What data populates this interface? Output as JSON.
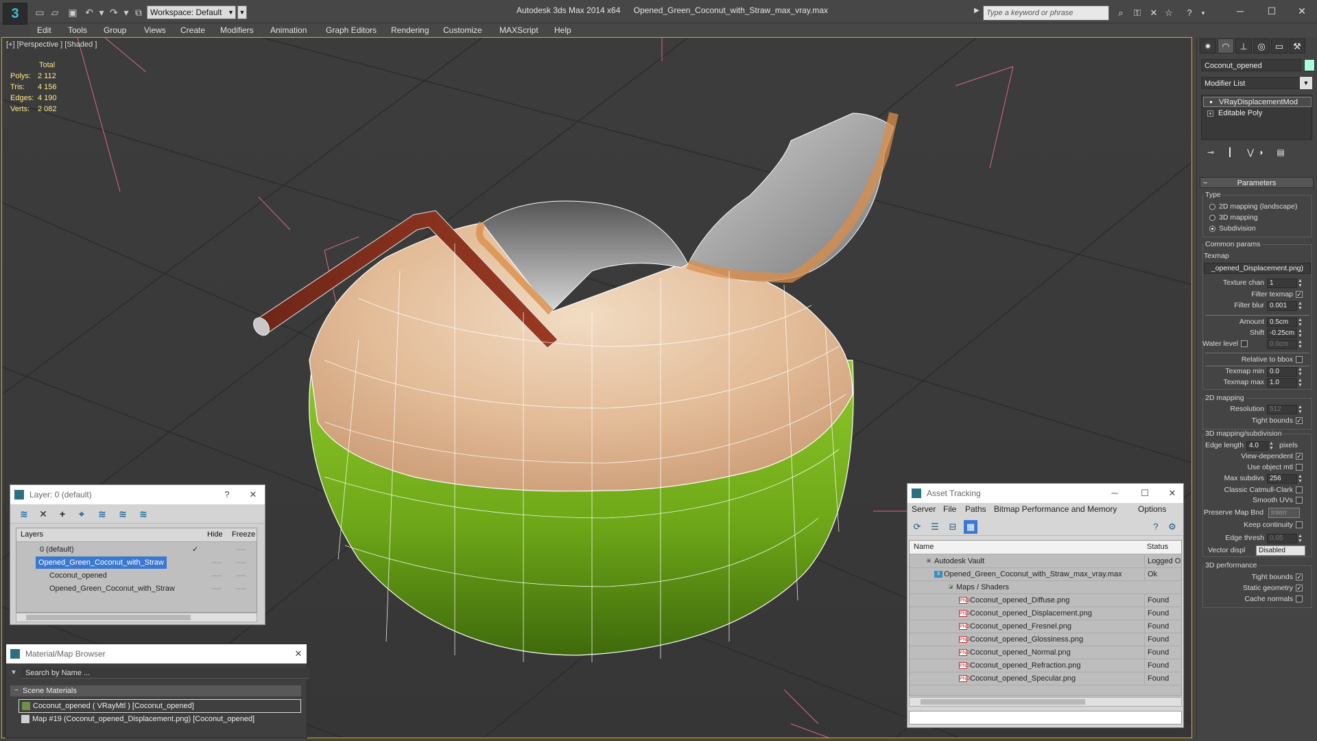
{
  "titlebar": {
    "workspace": "Workspace: Default",
    "app_name": "Autodesk 3ds Max  2014 x64",
    "file_name": "Opened_Green_Coconut_with_Straw_max_vray.max",
    "search_placeholder": "Type a keyword or phrase"
  },
  "menu": [
    "Edit",
    "Tools",
    "Group",
    "Views",
    "Create",
    "Modifiers",
    "Animation",
    "Graph Editors",
    "Rendering",
    "Customize",
    "MAXScript",
    "Help"
  ],
  "viewport": {
    "label": "[+] [Perspective ] [Shaded ]",
    "stats": {
      "header": "Total",
      "rows": [
        {
          "k": "Polys:",
          "v": "2 112"
        },
        {
          "k": "Tris:",
          "v": "4 156"
        },
        {
          "k": "Edges:",
          "v": "4 190"
        },
        {
          "k": "Verts:",
          "v": "2 082"
        }
      ]
    }
  },
  "layer_window": {
    "title": "Layer: 0 (default)",
    "help": "?",
    "close": "✕",
    "columns": {
      "layers": "Layers",
      "hide": "Hide",
      "freeze": "Freeze"
    },
    "rows": [
      {
        "name": "0 (default)",
        "hide": "✓",
        "freeze": "----"
      },
      {
        "name": "Opened_Green_Coconut_with_Straw",
        "hide": "----",
        "freeze": "----"
      },
      {
        "name": "Coconut_opened",
        "hide": "----",
        "freeze": "----"
      },
      {
        "name": "Opened_Green_Coconut_with_Straw",
        "hide": "----",
        "freeze": "----"
      }
    ]
  },
  "material_browser": {
    "title": "Material/Map Browser",
    "close": "✕",
    "search_placeholder": "Search by Name ...",
    "section": "Scene Materials",
    "rows": [
      "Coconut_opened  ( VRayMtl ) [Coconut_opened]",
      "Map #19 (Coconut_opened_Displacement.png) [Coconut_opened]"
    ]
  },
  "asset_tracking": {
    "title": "Asset Tracking",
    "menu": [
      "Server",
      "File",
      "Paths",
      "Bitmap Performance and Memory",
      "Options"
    ],
    "columns": {
      "name": "Name",
      "status": "Status"
    },
    "rows": [
      {
        "name": "Autodesk Vault",
        "status": "Logged O",
        "indent": 1
      },
      {
        "name": "Opened_Green_Coconut_with_Straw_max_vray.max",
        "status": "Ok",
        "indent": 2
      },
      {
        "name": "Maps / Shaders",
        "status": "",
        "indent": 3
      },
      {
        "name": "Coconut_opened_Diffuse.png",
        "status": "Found",
        "indent": 4
      },
      {
        "name": "Coconut_opened_Displacement.png",
        "status": "Found",
        "indent": 4
      },
      {
        "name": "Coconut_opened_Fresnel.png",
        "status": "Found",
        "indent": 4
      },
      {
        "name": "Coconut_opened_Glossiness.png",
        "status": "Found",
        "indent": 4
      },
      {
        "name": "Coconut_opened_Normal.png",
        "status": "Found",
        "indent": 4
      },
      {
        "name": "Coconut_opened_Refraction.png",
        "status": "Found",
        "indent": 4
      },
      {
        "name": "Coconut_opened_Specular.png",
        "status": "Found",
        "indent": 4
      }
    ]
  },
  "command_panel": {
    "object_name": "Coconut_opened",
    "object_color": "#a9ffd9",
    "modifier_list": "Modifier List",
    "stack": [
      "VRayDisplacementMod",
      "Editable Poly"
    ],
    "rollout": "Parameters",
    "type_group": "Type",
    "type_options": [
      "2D mapping (landscape)",
      "3D mapping",
      "Subdivision"
    ],
    "common_group": "Common params",
    "texmap_label": "Texmap",
    "texmap_value": "_opened_Displacement.png)",
    "params": [
      {
        "label": "Texture chan",
        "value": "1"
      },
      {
        "label": "Filter blur",
        "value": "0.001"
      },
      {
        "label": "Amount",
        "value": "0.5cm"
      },
      {
        "label": "Shift",
        "value": "-0.25cm"
      },
      {
        "label": "Water level",
        "value": "0.0cm"
      },
      {
        "label": "Texmap min",
        "value": "0.0"
      },
      {
        "label": "Texmap max",
        "value": "1.0"
      }
    ],
    "filter_texmap": "Filter texmap",
    "relative_bbox": "Relative to bbox",
    "mapping2d_group": "2D mapping",
    "resolution": {
      "label": "Resolution",
      "value": "512"
    },
    "tight_bounds": "Tight bounds",
    "mapping3d_group": "3D mapping/subdivision",
    "edge_length": {
      "label": "Edge length",
      "value": "4.0",
      "unit": "pixels"
    },
    "view_dependent": "View-dependent",
    "use_object_mtl": "Use object mtl",
    "max_subdivs": {
      "label": "Max subdivs",
      "value": "256"
    },
    "classic_catmull": "Classic Catmull-Clark",
    "smooth_uvs": "Smooth UVs",
    "preserve_map": {
      "label": "Preserve Map Bnd",
      "value": "Interr"
    },
    "keep_continuity": "Keep continuity",
    "edge_thresh": {
      "label": "Edge thresh",
      "value": "0.05"
    },
    "vector_displ": {
      "label": "Vector displ",
      "value": "Disabled"
    },
    "perf_group": "3D performance",
    "perf_tight_bounds": "Tight bounds",
    "static_geometry": "Static geometry",
    "cache_normals": "Cache normals"
  },
  "colors": {
    "viewport_border": "#e8a800",
    "stats_text": "#ffe98a",
    "selection": "#3b79d0",
    "coconut_green": "#7fb81c",
    "coconut_flesh": "#e8c9a8",
    "straw": "#7a2a1a"
  }
}
